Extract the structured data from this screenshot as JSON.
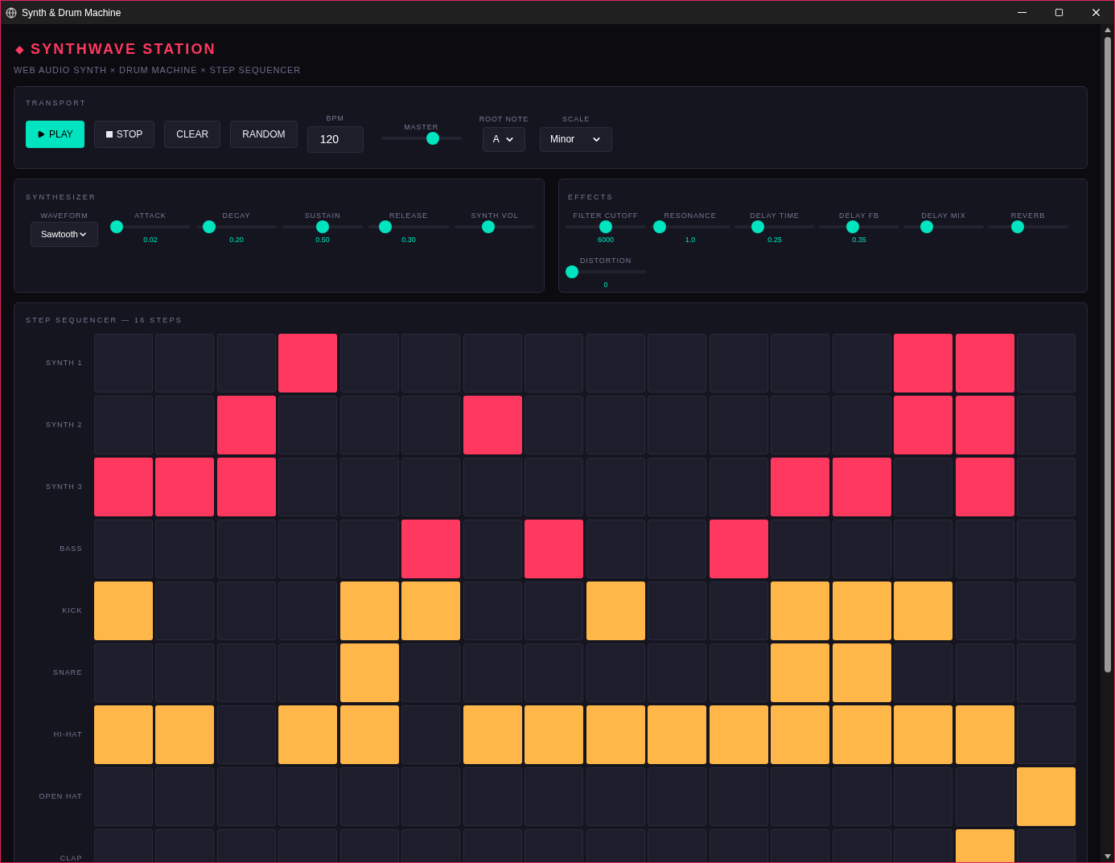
{
  "window": {
    "title": "Synth & Drum Machine"
  },
  "header": {
    "mark": "◆",
    "title": "SYNTHWAVE STATION",
    "subtitle": "WEB AUDIO SYNTH × DRUM MACHINE × STEP SEQUENCER"
  },
  "transport": {
    "title": "TRANSPORT",
    "buttons": [
      {
        "label": "PLAY",
        "kind": "play"
      },
      {
        "label": "STOP",
        "kind": "stop"
      },
      {
        "label": "CLEAR",
        "kind": "plain"
      },
      {
        "label": "RANDOM",
        "kind": "plain"
      }
    ],
    "bpm": {
      "label": "BPM",
      "value": "120"
    },
    "master": {
      "label": "MASTER",
      "level": 0.67
    },
    "root_note": {
      "label": "ROOT NOTE",
      "value": "A"
    },
    "scale": {
      "label": "SCALE",
      "value": "Minor"
    }
  },
  "synthesizer": {
    "title": "SYNTHESIZER",
    "waveform": {
      "label": "WAVEFORM",
      "value": "Sawtooth"
    },
    "sliders": [
      {
        "label": "ATTACK",
        "level": 0.0,
        "reading": "0.02"
      },
      {
        "label": "DECAY",
        "level": 0.1,
        "reading": "0.20"
      },
      {
        "label": "SUSTAIN",
        "level": 0.5,
        "reading": "0.50"
      },
      {
        "label": "RELEASE",
        "level": 0.15,
        "reading": "0.30"
      },
      {
        "label": "SYNTH VOL",
        "level": 0.4
      }
    ]
  },
  "effects": {
    "title": "EFFECTS",
    "sliders": [
      {
        "label": "FILTER CUTOFF",
        "level": 0.5,
        "reading": "6000"
      },
      {
        "label": "RESONANCE",
        "level": 0.05,
        "reading": "1.0"
      },
      {
        "label": "DELAY TIME",
        "level": 0.25,
        "reading": "0.25"
      },
      {
        "label": "DELAY FB",
        "level": 0.4,
        "reading": "0.35"
      },
      {
        "label": "DELAY MIX",
        "level": 0.25
      },
      {
        "label": "REVERB",
        "level": 0.35
      },
      {
        "label": "DISTORTION",
        "level": 0.0,
        "reading": "0"
      }
    ]
  },
  "sequencer": {
    "title": "STEP SEQUENCER — 16 STEPS",
    "rows": [
      {
        "label": "SYNTH 1",
        "kind": "synth",
        "steps": [
          false,
          false,
          false,
          true,
          false,
          false,
          false,
          false,
          false,
          false,
          false,
          false,
          false,
          true,
          true,
          false
        ]
      },
      {
        "label": "SYNTH 2",
        "kind": "synth",
        "steps": [
          false,
          false,
          true,
          false,
          false,
          false,
          true,
          false,
          false,
          false,
          false,
          false,
          false,
          true,
          true,
          false
        ]
      },
      {
        "label": "SYNTH 3",
        "kind": "synth",
        "steps": [
          true,
          true,
          true,
          false,
          false,
          false,
          false,
          false,
          false,
          false,
          false,
          true,
          true,
          false,
          true,
          false
        ]
      },
      {
        "label": "BASS",
        "kind": "synth",
        "steps": [
          false,
          false,
          false,
          false,
          false,
          true,
          false,
          true,
          false,
          false,
          true,
          false,
          false,
          false,
          false,
          false
        ]
      },
      {
        "label": "KICK",
        "kind": "drum",
        "steps": [
          true,
          false,
          false,
          false,
          true,
          true,
          false,
          false,
          true,
          false,
          false,
          true,
          true,
          true,
          false,
          false
        ]
      },
      {
        "label": "SNARE",
        "kind": "drum",
        "steps": [
          false,
          false,
          false,
          false,
          true,
          false,
          false,
          false,
          false,
          false,
          false,
          true,
          true,
          false,
          false,
          false
        ]
      },
      {
        "label": "HI-HAT",
        "kind": "drum",
        "steps": [
          true,
          true,
          false,
          true,
          true,
          false,
          true,
          true,
          true,
          true,
          true,
          true,
          true,
          true,
          true,
          false
        ]
      },
      {
        "label": "OPEN HAT",
        "kind": "drum",
        "steps": [
          false,
          false,
          false,
          false,
          false,
          false,
          false,
          false,
          false,
          false,
          false,
          false,
          false,
          false,
          false,
          true
        ]
      },
      {
        "label": "CLAP",
        "kind": "drum",
        "steps": [
          false,
          false,
          false,
          false,
          false,
          false,
          false,
          false,
          false,
          false,
          false,
          false,
          false,
          false,
          true,
          false
        ]
      }
    ]
  }
}
